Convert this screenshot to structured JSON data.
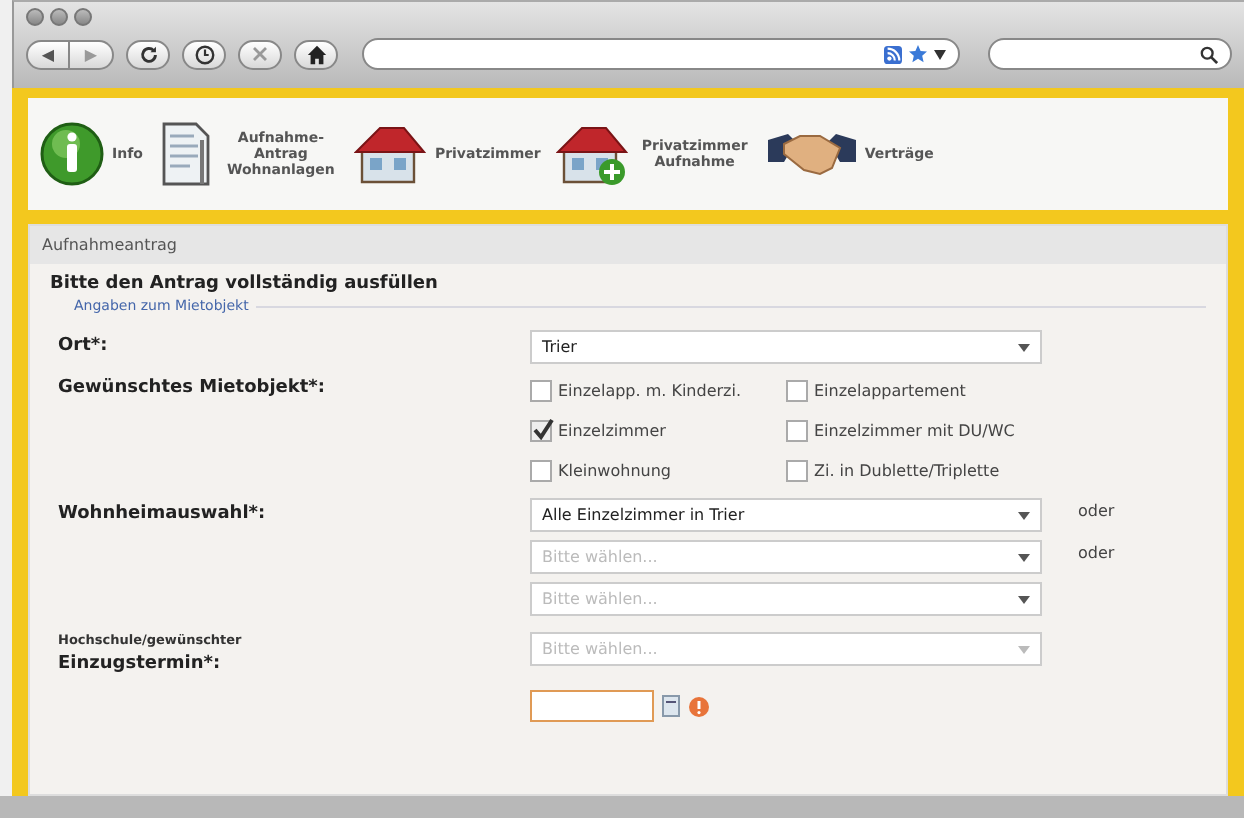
{
  "browser": {
    "back": "◀",
    "forward": "▶"
  },
  "nav": [
    {
      "kind": "info",
      "label": "Info"
    },
    {
      "kind": "document",
      "label": "Aufnahme-Antrag Wohnanlagen"
    },
    {
      "kind": "house",
      "label": "Privatzimmer"
    },
    {
      "kind": "house-plus",
      "label": "Privatzimmer Aufnahme"
    },
    {
      "kind": "handshake",
      "label": "Verträge"
    }
  ],
  "panel": {
    "title": "Aufnahmeantrag",
    "heading": "Bitte den Antrag vollständig ausfüllen",
    "legend": "Angaben zum Mietobjekt"
  },
  "form": {
    "ort": {
      "label": "Ort*:",
      "value": "Trier"
    },
    "mietobjekt": {
      "label": "Gewünschtes Mietobjekt*:",
      "options": [
        {
          "label": "Einzelapp. m. Kinderzi.",
          "checked": false
        },
        {
          "label": "Einzelappartement",
          "checked": false
        },
        {
          "label": "Einzelzimmer",
          "checked": true
        },
        {
          "label": "Einzelzimmer mit DU/WC",
          "checked": false
        },
        {
          "label": "Kleinwohnung",
          "checked": false
        },
        {
          "label": "Zi. in Dublette/Triplette",
          "checked": false
        }
      ]
    },
    "wohnheim": {
      "label": "Wohnheimauswahl*:",
      "selects": [
        {
          "value": "Alle Einzelzimmer in Trier",
          "suffix": "oder"
        },
        {
          "placeholder": "Bitte wählen...",
          "suffix": "oder"
        },
        {
          "placeholder": "Bitte wählen..."
        }
      ]
    },
    "hochschule": {
      "label_small": "Hochschule/gewünschter",
      "label": "Einzugstermin*:",
      "placeholder": "Bitte wählen..."
    }
  }
}
